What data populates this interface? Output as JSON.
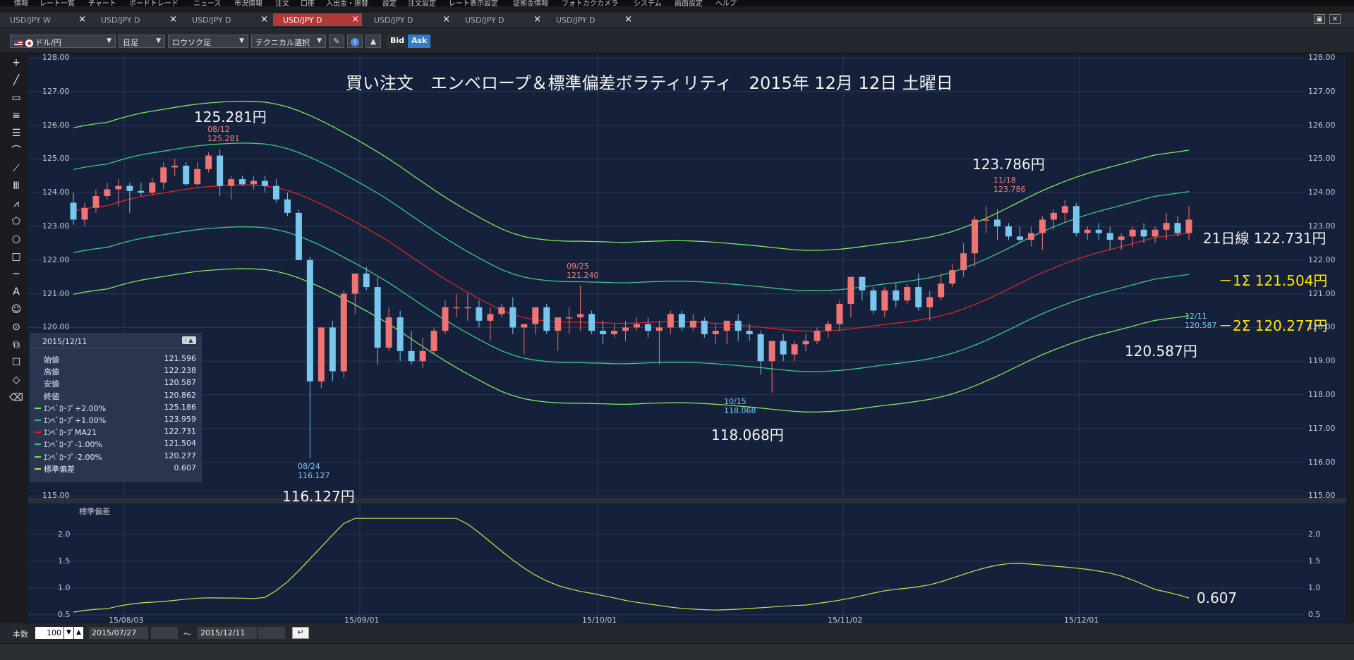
{
  "menu": [
    "情報",
    "レート一覧",
    "チャート",
    "ボードトレード",
    "ニュース",
    "市況情報",
    "注文",
    "口座",
    "入出金・振替",
    "設定",
    "注文設定",
    "レート表示設定",
    "証拠金情報",
    "フォトカクカメラ",
    "システム",
    "画面設定",
    "ヘルプ"
  ],
  "tabs": [
    {
      "label": "USD/JPY W",
      "active": false,
      "closable": true
    },
    {
      "label": "USD/JPY D",
      "active": false,
      "closable": true
    },
    {
      "label": "USD/JPY D",
      "active": false,
      "closable": true
    },
    {
      "label": "USD/JPY D",
      "active": true,
      "closable": true
    },
    {
      "label": "USD/JPY D",
      "active": false,
      "closable": true
    },
    {
      "label": "USD/JPY D",
      "active": false,
      "closable": true
    },
    {
      "label": "USD/JPY D",
      "active": false,
      "closable": true
    }
  ],
  "toolbar": {
    "pair": "ドル/円",
    "period": "日足",
    "chart_type": "ロウソク足",
    "technical": "テクニカル選択",
    "bid": "Bid",
    "ask": "Ask"
  },
  "side_tools": [
    "crosshair-tool",
    "trendline-tool",
    "ray-tool",
    "horizontal-lines-tool",
    "parallel-lines-tool",
    "arc-tool",
    "fan-tool",
    "fibonacci-tool",
    "pitchfork-tool",
    "pentagon-tool",
    "circle-tool",
    "rectangle-tool",
    "hline-tool",
    "text-tool",
    "icon-tool",
    "magnet-tool",
    "copy-tool",
    "select-tool",
    "eraser-tool",
    "delete-tool"
  ],
  "chart": {
    "title": "買い注文　エンベロープ＆標準偏差ボラティリティ　2015年 12月 12日 土曜日",
    "annotations": {
      "high_125": "125.281円",
      "low_116": "116.127円",
      "low_118": "118.068円",
      "high_123": "123.786円",
      "last_120": "120.587円",
      "ma21": "21日線 122.731円",
      "minus1": "－1Σ 121.504円",
      "minus2": "－2Σ 120.277円",
      "stddev": "0.607"
    },
    "marks": {
      "m0812_date": "08/12",
      "m0812_val": "125.281",
      "m0824_date": "08/24",
      "m0824_val": "116.127",
      "m0925_date": "09/25",
      "m0925_val": "121.240",
      "m1015_date": "10/15",
      "m1015_val": "118.068",
      "m1118_date": "11/18",
      "m1118_val": "123.786",
      "m1211_date": "12/11",
      "m1211_val": "120.587"
    },
    "y_ticks": [
      "128.00",
      "127.00",
      "126.00",
      "125.00",
      "124.00",
      "123.00",
      "122.00",
      "121.00",
      "120.00",
      "119.00",
      "118.00",
      "117.00",
      "116.00",
      "115.00"
    ],
    "x_ticks": [
      "15/08/03",
      "15/09/01",
      "15/10/01",
      "15/11/02",
      "15/12/01"
    ],
    "sub_caption": "標準偏差",
    "sub_ticks": [
      "2.0",
      "1.5",
      "1.0",
      "0.5"
    ]
  },
  "info": {
    "date": "2015/12/11",
    "rows": [
      {
        "label": "始値",
        "value": "121.596"
      },
      {
        "label": "高値",
        "value": "122.238"
      },
      {
        "label": "安値",
        "value": "120.587"
      },
      {
        "label": "終値",
        "value": "120.862"
      },
      {
        "label": "ｴﾝﾍﾞﾛｰﾌﾟ+2.00%",
        "value": "125.186"
      },
      {
        "label": "ｴﾝﾍﾞﾛｰﾌﾟ+1.00%",
        "value": "123.959"
      },
      {
        "label": "ｴﾝﾍﾞﾛｰﾌﾟMA21",
        "value": "122.731"
      },
      {
        "label": "ｴﾝﾍﾞﾛｰﾌﾟ-1.00%",
        "value": "121.504"
      },
      {
        "label": "ｴﾝﾍﾞﾛｰﾌﾟ-2.00%",
        "value": "120.277"
      },
      {
        "label": "標準偏差",
        "value": "0.607"
      }
    ]
  },
  "bottom": {
    "count_label": "本数",
    "count_value": "100",
    "from_date": "2015/07/27",
    "tilde": "〜",
    "to_date": "2015/12/11"
  },
  "colors": {
    "background": "#15203a",
    "up_candle": "#f07474",
    "down_candle": "#78c8ee",
    "ma21": "#d8262f",
    "env_outer": "#7ee85c",
    "env_inner": "#38c888",
    "stddev_line": "#c6e44a",
    "annotation_yellow": "#ffe400"
  },
  "chart_data": {
    "type": "candlestick",
    "title": "買い注文　エンベロープ＆標準偏差ボラティリティ　2015年 12月 12日 土曜日",
    "xlabel": "",
    "ylabel": "",
    "ylim": [
      115,
      128
    ],
    "grid": true,
    "x_ticks": [
      "15/08/03",
      "15/09/01",
      "15/10/01",
      "15/11/02",
      "15/12/01"
    ],
    "key_points": [
      {
        "date": "08/12",
        "value": 125.281,
        "kind": "high"
      },
      {
        "date": "08/24",
        "value": 116.127,
        "kind": "low"
      },
      {
        "date": "09/25",
        "value": 121.24,
        "kind": "high"
      },
      {
        "date": "10/15",
        "value": 118.068,
        "kind": "low"
      },
      {
        "date": "11/18",
        "value": 123.786,
        "kind": "high"
      },
      {
        "date": "12/11",
        "value": 120.587,
        "kind": "low"
      }
    ],
    "last_bar": {
      "date": "2015/12/11",
      "open": 121.596,
      "high": 122.238,
      "low": 120.587,
      "close": 120.862
    },
    "candles_ohlc": [
      [
        123.7,
        124.0,
        123.05,
        123.2
      ],
      [
        123.2,
        123.7,
        123.0,
        123.55
      ],
      [
        123.55,
        124.1,
        123.4,
        123.9
      ],
      [
        123.9,
        124.3,
        123.8,
        124.1
      ],
      [
        124.1,
        124.4,
        123.6,
        124.2
      ],
      [
        124.2,
        124.3,
        123.4,
        124.05
      ],
      [
        124.05,
        124.3,
        123.9,
        124.0
      ],
      [
        124.0,
        124.45,
        123.9,
        124.3
      ],
      [
        124.3,
        124.9,
        124.1,
        124.75
      ],
      [
        124.75,
        125.0,
        124.5,
        124.8
      ],
      [
        124.8,
        124.9,
        124.2,
        124.25
      ],
      [
        124.25,
        124.9,
        124.2,
        124.7
      ],
      [
        124.7,
        125.2,
        124.6,
        125.1
      ],
      [
        125.1,
        125.28,
        123.9,
        124.2
      ],
      [
        124.2,
        124.5,
        123.8,
        124.4
      ],
      [
        124.4,
        124.5,
        124.2,
        124.25
      ],
      [
        124.25,
        124.5,
        124.1,
        124.35
      ],
      [
        124.35,
        124.5,
        124.0,
        124.2
      ],
      [
        124.2,
        124.4,
        123.7,
        123.8
      ],
      [
        123.8,
        124.0,
        123.3,
        123.4
      ],
      [
        123.4,
        123.5,
        122.0,
        122.0
      ],
      [
        122.0,
        122.1,
        116.127,
        118.4
      ],
      [
        118.4,
        119.7,
        118.2,
        120.0
      ],
      [
        120.0,
        120.2,
        118.4,
        118.7
      ],
      [
        118.7,
        121.1,
        118.5,
        121.0
      ],
      [
        121.0,
        121.6,
        120.4,
        121.6
      ],
      [
        121.6,
        121.8,
        121.1,
        121.2
      ],
      [
        121.2,
        121.5,
        118.9,
        119.4
      ],
      [
        119.4,
        120.6,
        119.3,
        120.3
      ],
      [
        120.3,
        120.5,
        119.0,
        119.3
      ],
      [
        119.3,
        119.9,
        118.9,
        119.0
      ],
      [
        119.0,
        119.7,
        118.8,
        119.3
      ],
      [
        119.3,
        120.0,
        119.2,
        119.9
      ],
      [
        119.9,
        120.8,
        119.8,
        120.6
      ],
      [
        120.6,
        121.0,
        120.3,
        120.6
      ],
      [
        120.6,
        121.0,
        120.2,
        120.6
      ],
      [
        120.6,
        120.8,
        120.0,
        120.2
      ],
      [
        120.2,
        120.6,
        119.6,
        120.4
      ],
      [
        120.4,
        120.7,
        120.3,
        120.6
      ],
      [
        120.6,
        120.9,
        119.8,
        120.0
      ],
      [
        120.0,
        120.1,
        119.2,
        120.1
      ],
      [
        120.1,
        120.6,
        119.8,
        120.6
      ],
      [
        120.6,
        120.7,
        119.8,
        119.9
      ],
      [
        119.9,
        120.2,
        119.3,
        120.3
      ],
      [
        120.3,
        120.6,
        119.8,
        120.3
      ],
      [
        120.3,
        121.24,
        119.9,
        120.4
      ],
      [
        120.4,
        120.5,
        119.8,
        119.9
      ],
      [
        119.9,
        120.2,
        119.5,
        119.8
      ],
      [
        119.8,
        120.1,
        119.7,
        119.9
      ],
      [
        119.9,
        120.2,
        119.6,
        120.0
      ],
      [
        120.0,
        120.3,
        119.9,
        120.1
      ],
      [
        120.1,
        120.3,
        119.7,
        119.9
      ],
      [
        119.9,
        120.2,
        118.9,
        120.0
      ],
      [
        120.0,
        120.5,
        119.8,
        120.4
      ],
      [
        120.4,
        120.5,
        119.9,
        120.0
      ],
      [
        120.0,
        120.4,
        119.9,
        120.2
      ],
      [
        120.2,
        120.3,
        119.7,
        119.8
      ],
      [
        119.8,
        120.1,
        119.5,
        119.9
      ],
      [
        119.9,
        120.2,
        119.5,
        120.2
      ],
      [
        120.2,
        120.4,
        119.6,
        119.9
      ],
      [
        119.9,
        120.1,
        119.6,
        119.8
      ],
      [
        119.8,
        119.9,
        118.6,
        119.0
      ],
      [
        119.0,
        119.1,
        118.068,
        119.6
      ],
      [
        119.6,
        119.8,
        119.0,
        119.2
      ],
      [
        119.2,
        119.6,
        119.0,
        119.5
      ],
      [
        119.5,
        119.8,
        119.3,
        119.6
      ],
      [
        119.6,
        120.0,
        119.5,
        119.9
      ],
      [
        119.9,
        120.2,
        119.7,
        120.1
      ],
      [
        120.1,
        120.8,
        119.9,
        120.7
      ],
      [
        120.7,
        121.5,
        120.3,
        121.5
      ],
      [
        121.5,
        121.5,
        120.8,
        121.1
      ],
      [
        121.1,
        121.2,
        120.4,
        120.5
      ],
      [
        120.5,
        121.2,
        120.3,
        121.1
      ],
      [
        121.1,
        121.3,
        120.6,
        120.8
      ],
      [
        120.8,
        121.3,
        120.7,
        121.2
      ],
      [
        121.2,
        121.6,
        120.5,
        120.6
      ],
      [
        120.6,
        121.1,
        120.2,
        120.9
      ],
      [
        120.9,
        121.6,
        120.8,
        121.3
      ],
      [
        121.3,
        121.9,
        121.2,
        121.7
      ],
      [
        121.7,
        122.5,
        121.5,
        122.2
      ],
      [
        122.2,
        123.3,
        121.8,
        123.2
      ],
      [
        123.2,
        123.6,
        122.8,
        123.2
      ],
      [
        123.2,
        123.5,
        122.6,
        123.0
      ],
      [
        123.0,
        123.1,
        122.6,
        122.7
      ],
      [
        122.7,
        123.0,
        122.5,
        122.6
      ],
      [
        122.6,
        123.0,
        122.4,
        122.8
      ],
      [
        122.8,
        123.3,
        122.3,
        123.2
      ],
      [
        123.2,
        123.5,
        122.9,
        123.4
      ],
      [
        123.4,
        123.786,
        123.1,
        123.6
      ],
      [
        123.6,
        123.7,
        122.7,
        122.8
      ],
      [
        122.8,
        123.0,
        122.6,
        122.9
      ],
      [
        122.9,
        123.1,
        122.6,
        122.8
      ],
      [
        122.8,
        123.0,
        122.3,
        122.6
      ],
      [
        122.6,
        122.8,
        122.3,
        122.7
      ],
      [
        122.7,
        123.0,
        122.4,
        122.9
      ],
      [
        122.9,
        123.1,
        122.5,
        122.7
      ],
      [
        122.7,
        123.0,
        122.5,
        122.9
      ],
      [
        122.9,
        123.4,
        122.6,
        123.1
      ],
      [
        123.1,
        123.3,
        122.7,
        122.8
      ],
      [
        122.8,
        123.6,
        122.6,
        123.2
      ]
    ],
    "series": [
      {
        "name": "ｴﾝﾍﾞﾛｰﾌﾟ+2.00%",
        "last": 125.186
      },
      {
        "name": "ｴﾝﾍﾞﾛｰﾌﾟ+1.00%",
        "last": 123.959
      },
      {
        "name": "ｴﾝﾍﾞﾛｰﾌﾟMA21",
        "last": 122.731
      },
      {
        "name": "ｴﾝﾍﾞﾛｰﾌﾟ-1.00%",
        "last": 121.504
      },
      {
        "name": "ｴﾝﾍﾞﾛｰﾌﾟ-2.00%",
        "last": 120.277
      },
      {
        "name": "標準偏差",
        "last": 0.607,
        "ylim": [
          0.3,
          2.3
        ]
      }
    ]
  }
}
